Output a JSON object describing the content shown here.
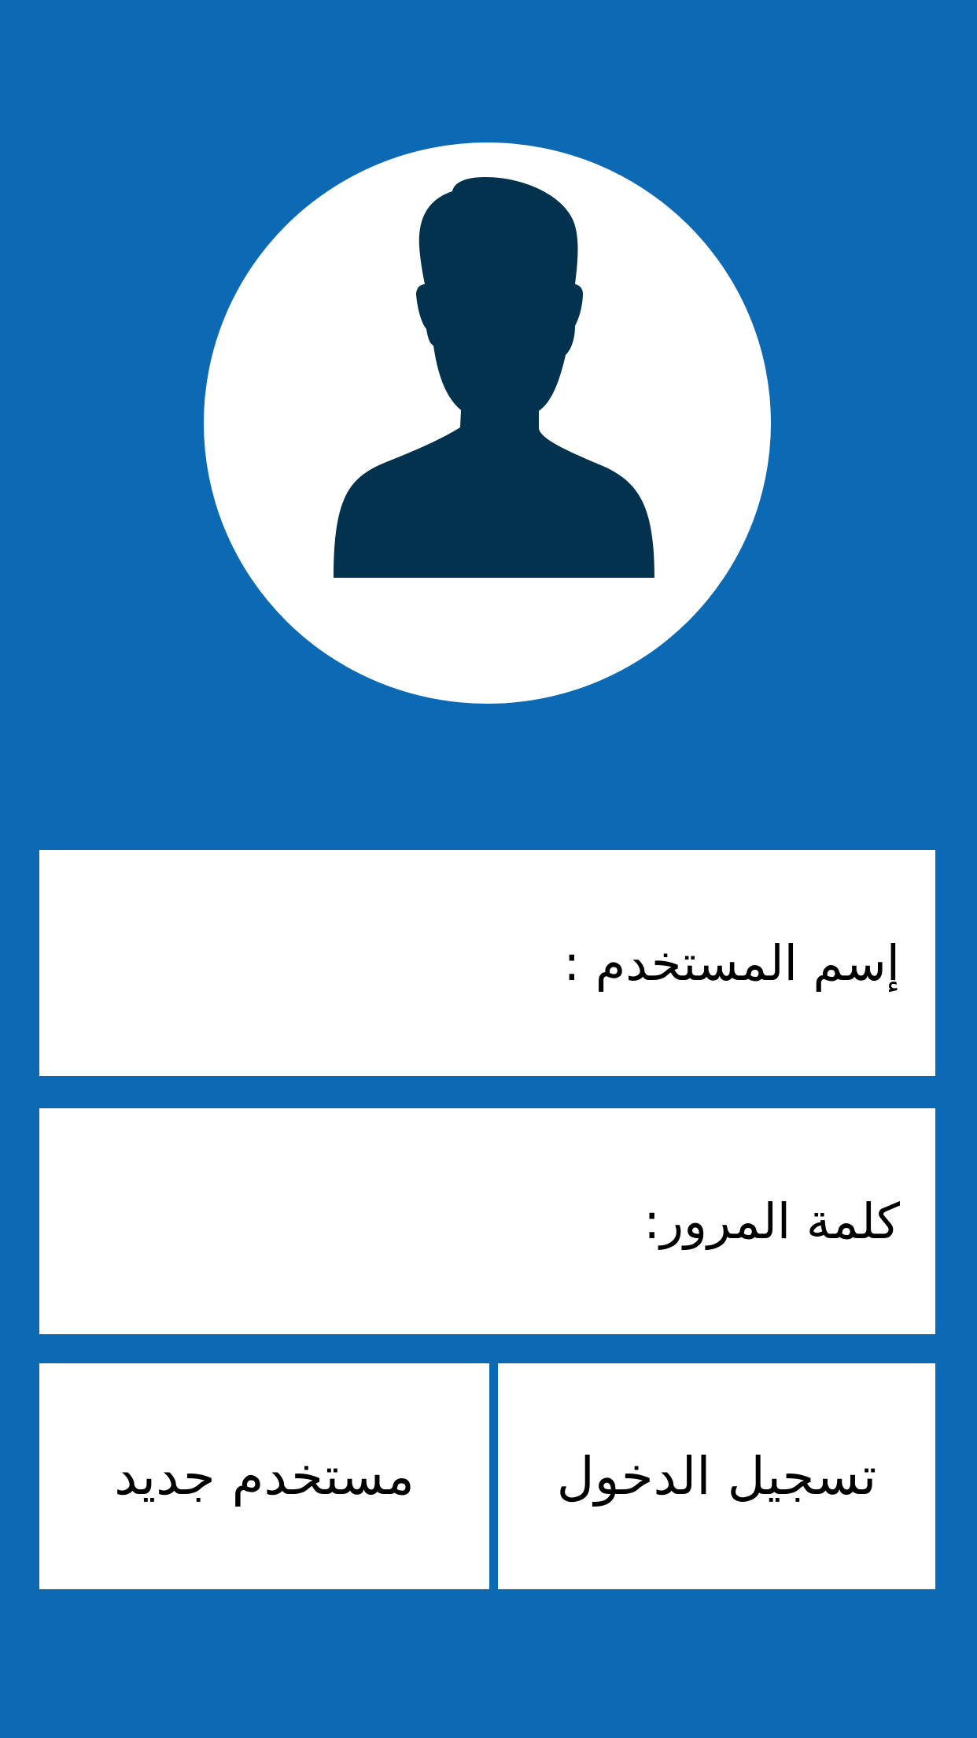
{
  "avatar": {
    "icon": "user-silhouette-icon",
    "circle_color": "#ffffff",
    "silhouette_color": "#03324f"
  },
  "form": {
    "username_label": "إسم المستخدم :",
    "username_value": "",
    "password_label": "كلمة المرور:",
    "password_value": ""
  },
  "buttons": {
    "login_label": "تسجيل الدخول",
    "register_label": "مستخدم جديد"
  },
  "colors": {
    "background": "#0c69b3",
    "panel": "#ffffff",
    "text": "#000000"
  }
}
